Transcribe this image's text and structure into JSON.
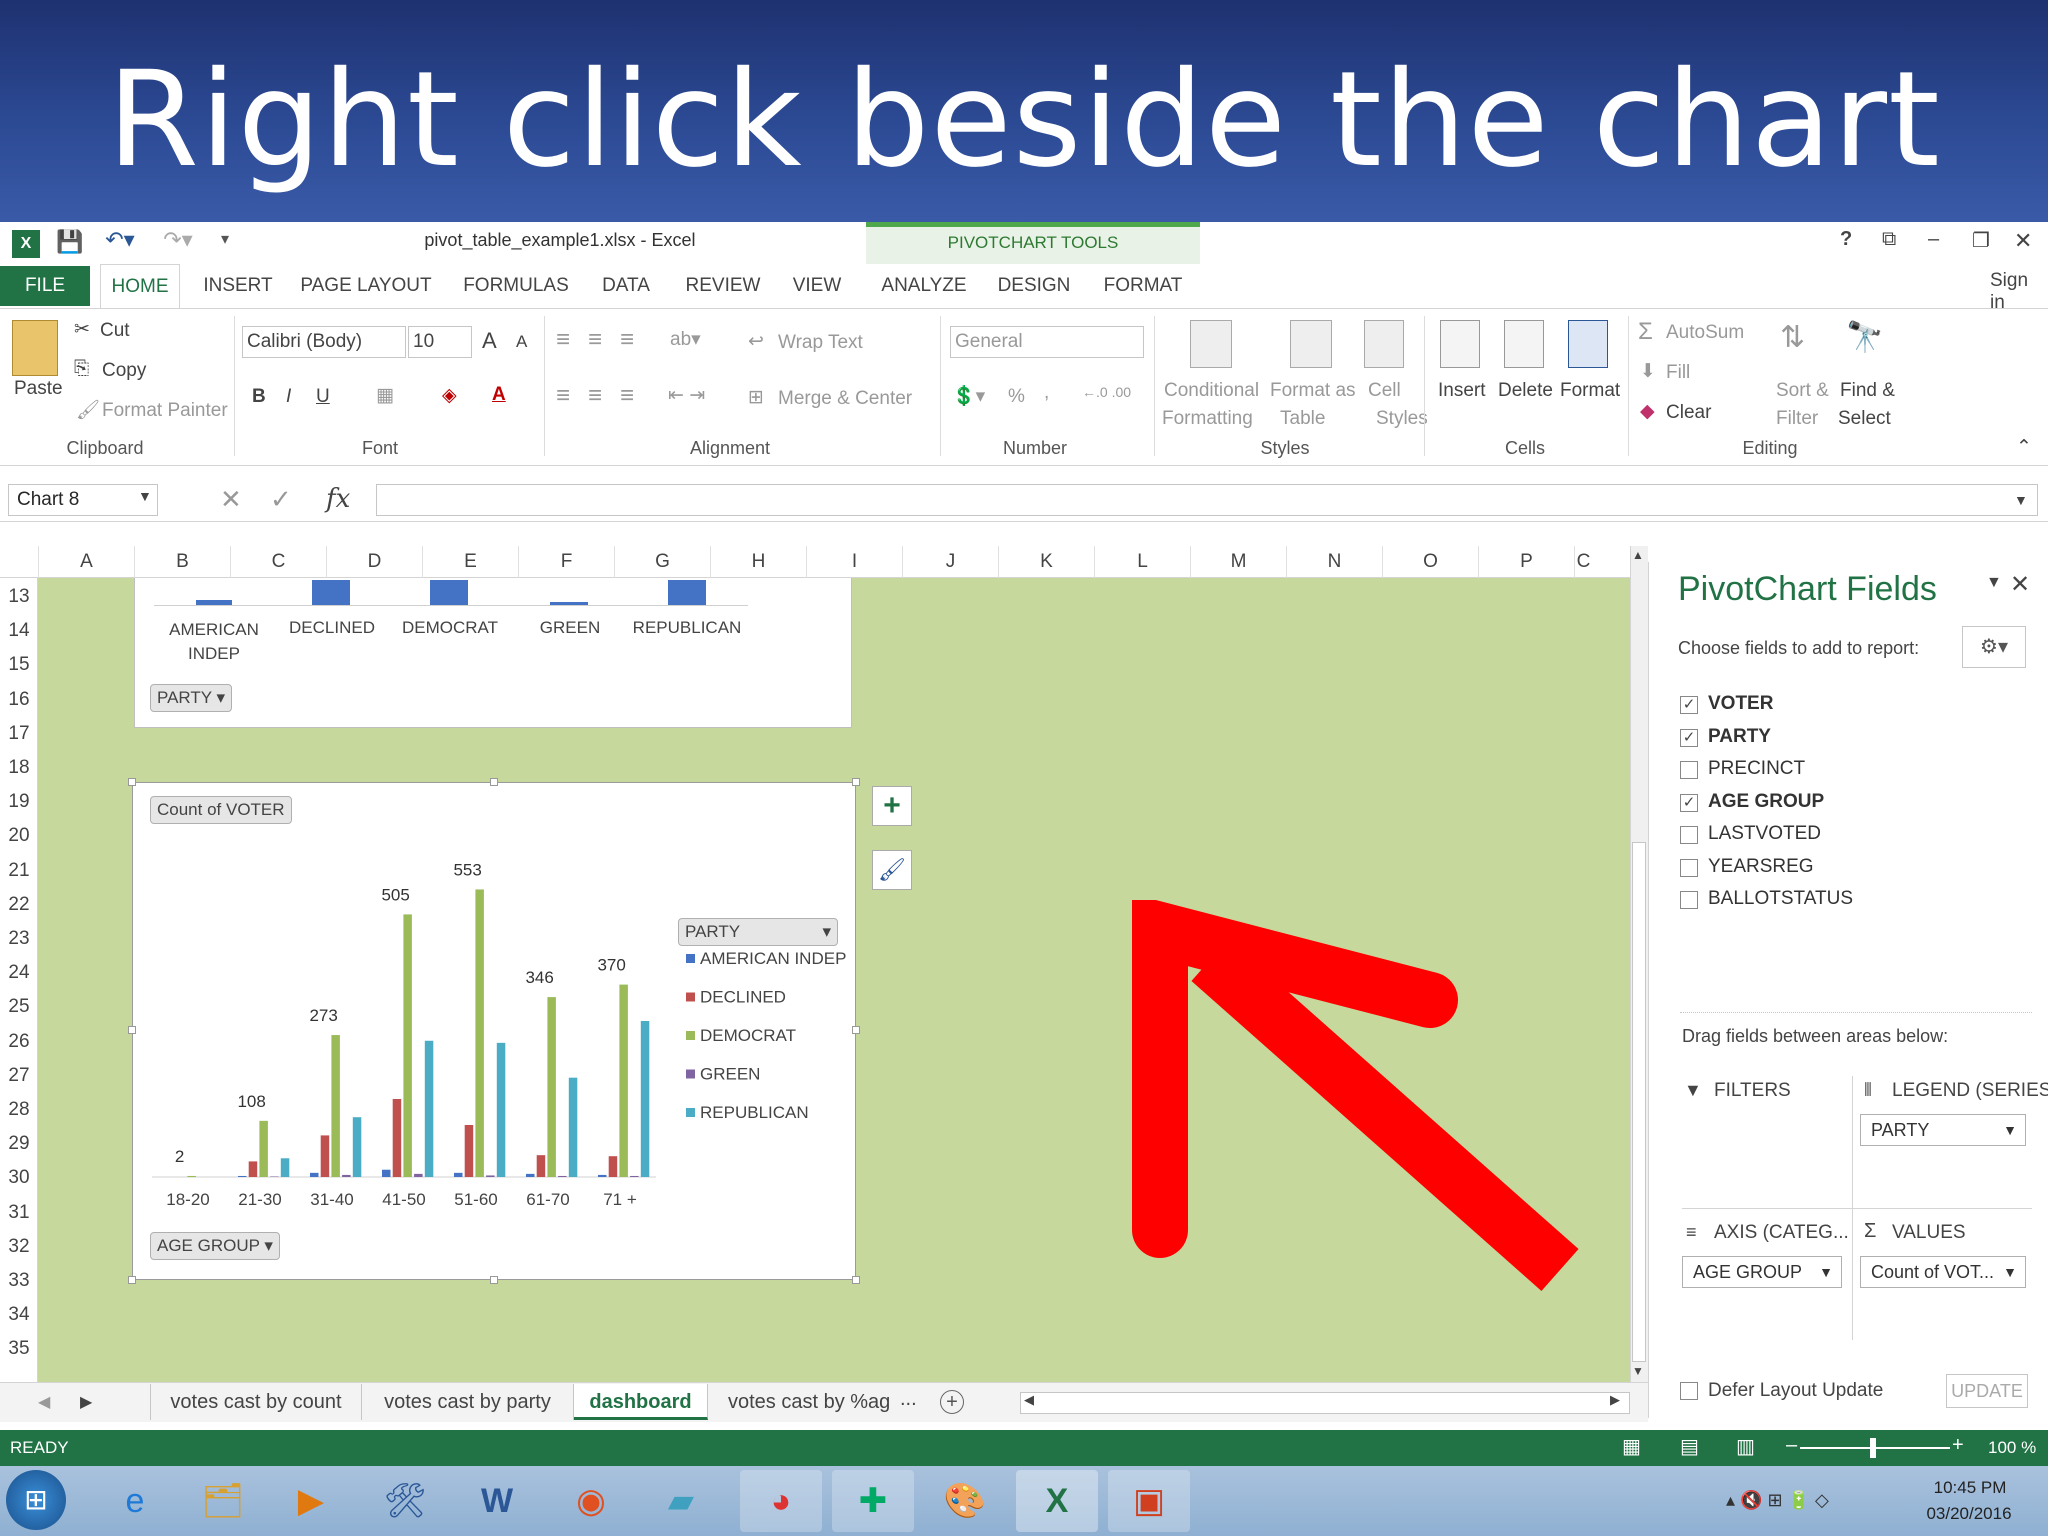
{
  "slide": {
    "title": "Right click beside the chart"
  },
  "window": {
    "doc_title": "pivot_table_example1.xlsx - Excel",
    "context_title": "PIVOTCHART TOOLS",
    "help": "?",
    "sign_in": "Sign in"
  },
  "tabs": {
    "file": "FILE",
    "home": "HOME",
    "insert": "INSERT",
    "page_layout": "PAGE LAYOUT",
    "formulas": "FORMULAS",
    "data": "DATA",
    "review": "REVIEW",
    "view": "VIEW",
    "analyze": "ANALYZE",
    "design": "DESIGN",
    "format": "FORMAT"
  },
  "ribbon": {
    "clipboard": {
      "paste": "Paste",
      "cut": "Cut",
      "copy": "Copy",
      "format_painter": "Format Painter",
      "label": "Clipboard"
    },
    "font": {
      "name": "Calibri (Body)",
      "size": "10",
      "label": "Font",
      "bold": "B",
      "italic": "I",
      "underline": "U",
      "grow": "A",
      "shrink": "A"
    },
    "alignment": {
      "wrap": "Wrap Text",
      "merge": "Merge & Center",
      "label": "Alignment"
    },
    "number": {
      "format": "General",
      "percent": "%",
      "comma": ",",
      "label": "Number"
    },
    "styles": {
      "cond_1": "Conditional",
      "cond_2": "Formatting",
      "fmt_1": "Format as",
      "fmt_2": "Table",
      "cell_1": "Cell",
      "cell_2": "Styles",
      "label": "Styles"
    },
    "cells": {
      "insert": "Insert",
      "delete": "Delete",
      "format": "Format",
      "label": "Cells"
    },
    "editing": {
      "autosum": "AutoSum",
      "fill": "Fill",
      "clear": "Clear",
      "sort_1": "Sort &",
      "sort_2": "Filter",
      "find_1": "Find &",
      "find_2": "Select",
      "label": "Editing"
    }
  },
  "formula_bar": {
    "name_box": "Chart 8",
    "fx": "fx",
    "value": ""
  },
  "columns": [
    "A",
    "B",
    "C",
    "D",
    "E",
    "F",
    "G",
    "H",
    "I",
    "J",
    "K",
    "L",
    "M",
    "N",
    "O",
    "P",
    "C"
  ],
  "rows": [
    "13",
    "14",
    "15",
    "16",
    "17",
    "18",
    "19",
    "20",
    "21",
    "22",
    "23",
    "24",
    "25",
    "26",
    "27",
    "28",
    "29",
    "30",
    "31",
    "32",
    "33",
    "34",
    "35"
  ],
  "top_chart": {
    "categories": [
      "AMERICAN\nINDEP",
      "DECLINED",
      "DEMOCRAT",
      "GREEN",
      "REPUBLICAN"
    ],
    "filter_button": "PARTY"
  },
  "chart_data": {
    "type": "bar",
    "title": "",
    "value_button": "Count of VOTER",
    "axis_button": "AGE GROUP",
    "legend_title": "PARTY",
    "categories": [
      "18-20",
      "21-30",
      "31-40",
      "41-50",
      "51-60",
      "61-70",
      "71 +"
    ],
    "series": [
      {
        "name": "AMERICAN INDEP",
        "color": "#4472c4",
        "values": [
          0,
          2,
          8,
          14,
          8,
          6,
          4
        ]
      },
      {
        "name": "DECLINED",
        "color": "#c0504d",
        "values": [
          0,
          30,
          80,
          150,
          100,
          42,
          40
        ]
      },
      {
        "name": "DEMOCRAT",
        "color": "#9bbb59",
        "values": [
          2,
          108,
          273,
          505,
          553,
          346,
          370
        ]
      },
      {
        "name": "GREEN",
        "color": "#8064a2",
        "values": [
          0,
          1,
          4,
          6,
          3,
          2,
          2
        ]
      },
      {
        "name": "REPUBLICAN",
        "color": "#4bacc6",
        "values": [
          0,
          36,
          115,
          262,
          258,
          191,
          300
        ]
      }
    ],
    "data_labels": [
      "2",
      "108",
      "273",
      "505",
      "553",
      "346",
      "370"
    ],
    "ylim": [
      0,
      600
    ]
  },
  "pane": {
    "title": "PivotChart Fields",
    "subtitle": "Choose fields to add to report:",
    "fields": [
      {
        "name": "VOTER",
        "checked": true
      },
      {
        "name": "PARTY",
        "checked": true
      },
      {
        "name": "PRECINCT",
        "checked": false
      },
      {
        "name": "AGE GROUP",
        "checked": true
      },
      {
        "name": "LASTVOTED",
        "checked": false
      },
      {
        "name": "YEARSREG",
        "checked": false
      },
      {
        "name": "BALLOTSTATUS",
        "checked": false
      }
    ],
    "drag_text": "Drag fields between areas below:",
    "filters": "FILTERS",
    "legend": "LEGEND (SERIES)",
    "legend_value": "PARTY",
    "axis": "AXIS (CATEG...",
    "axis_value": "AGE GROUP",
    "values": "VALUES",
    "values_value": "Count of VOT...",
    "defer": "Defer Layout Update",
    "update": "UPDATE"
  },
  "sheet_tabs": [
    "votes cast by count",
    "votes cast by party",
    "dashboard",
    "votes cast by %ag"
  ],
  "sheet_tabs_more": "...",
  "status": {
    "ready": "READY",
    "zoom": "100 %"
  },
  "taskbar": {
    "time": "10:45 PM",
    "date": "03/20/2016"
  },
  "colors": {
    "excel_green": "#217346",
    "sheet_bg": "#c7d89c",
    "arrow": "#ff0000",
    "banner": "#2c4a94"
  }
}
